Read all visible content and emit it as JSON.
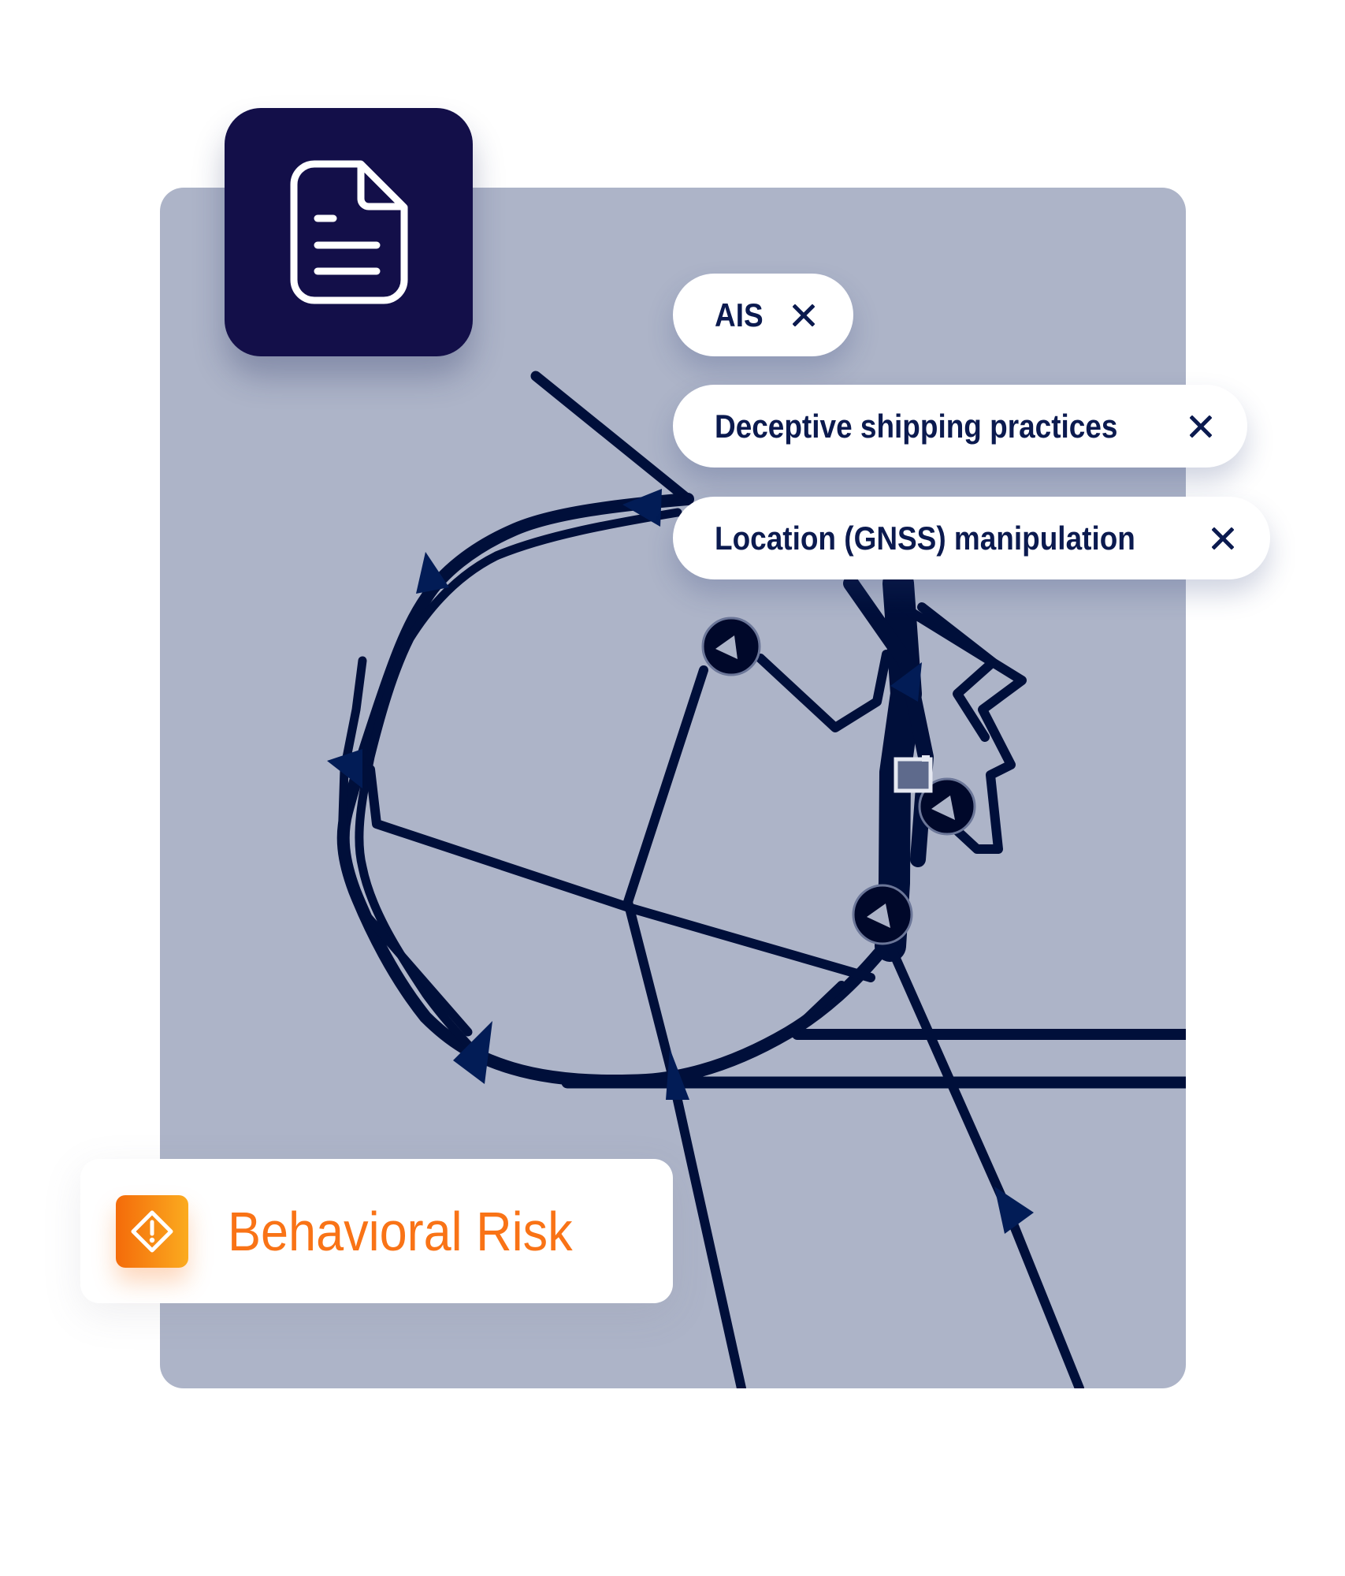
{
  "document_tile": {
    "icon": "document-icon",
    "color": "#130f49"
  },
  "map": {
    "background_color": "#adb4c8",
    "track_color": "#000f3a",
    "arrow_color": "#021c56",
    "vessel_marker_icon": "vessel-position-marker",
    "flag_icon": "vessel-flag-marker"
  },
  "filter_chips": [
    {
      "label": "AIS",
      "close_icon": "close-icon"
    },
    {
      "label": "Deceptive shipping practices",
      "close_icon": "close-icon"
    },
    {
      "label": "Location (GNSS) manipulation",
      "close_icon": "close-icon"
    }
  ],
  "risk_card": {
    "label": "Behavioral Risk",
    "icon": "warning-diamond-icon",
    "accent_color": "#f97316"
  }
}
